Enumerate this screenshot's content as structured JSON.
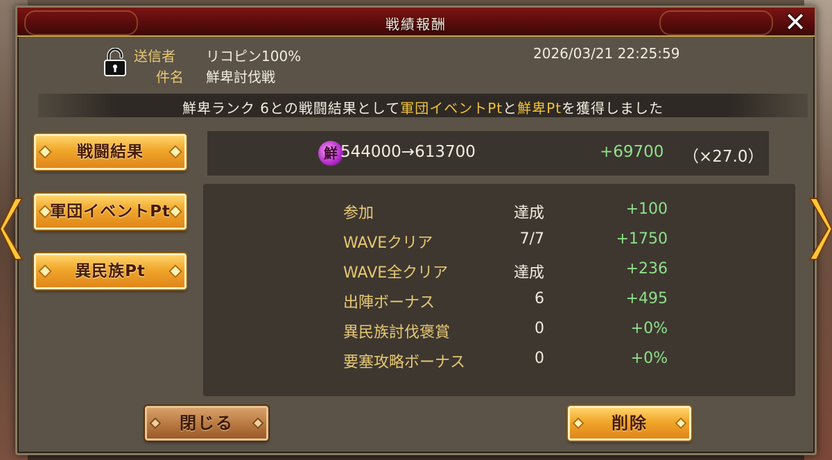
{
  "window": {
    "title": "戦績報酬"
  },
  "mail": {
    "sender_label": "送信者",
    "sender_value": "リコピン100%",
    "subject_label": "件名",
    "subject_value": "鮮卑討伐戦",
    "timestamp": "2026/03/21  22:25:59"
  },
  "notice": {
    "part1": "鮮卑ランク 6との戦闘結果として",
    "highlight1": "軍団イベントPt",
    "part2": "と",
    "highlight2": "鮮卑Pt",
    "part3": "を獲得しました"
  },
  "tabs": [
    {
      "label": "戦闘結果"
    },
    {
      "label": "軍団イベントPt"
    },
    {
      "label": "異民族Pt"
    }
  ],
  "score": {
    "icon_char": "鮮",
    "change_text": "544000→613700",
    "gain": "+69700",
    "multiplier": "（×27.0）"
  },
  "details": [
    {
      "name": "参加",
      "value": "達成",
      "points": "+100"
    },
    {
      "name": "WAVEクリア",
      "value": "7/7",
      "points": "+1750"
    },
    {
      "name": "WAVE全クリア",
      "value": "達成",
      "points": "+236"
    },
    {
      "name": "出陣ボーナス",
      "value": "6",
      "points": "+495"
    },
    {
      "name": "異民族討伐褒賞",
      "value": "0",
      "points": "+0%"
    },
    {
      "name": "要塞攻略ボーナス",
      "value": "0",
      "points": "+0%"
    }
  ],
  "buttons": {
    "close": "閉じる",
    "delete": "削除"
  },
  "icons": {
    "close": "close-icon",
    "lock": "lock-icon",
    "nav_left": "chevron-left-icon",
    "nav_right": "chevron-right-icon",
    "score": "xianbei-pt-icon"
  },
  "colors": {
    "title_bar": "#6a1010",
    "label_gold": "#e6c873",
    "highlight": "#f0c23a",
    "gain_green": "#8ee08a",
    "button_gold": "#f0a62a"
  }
}
